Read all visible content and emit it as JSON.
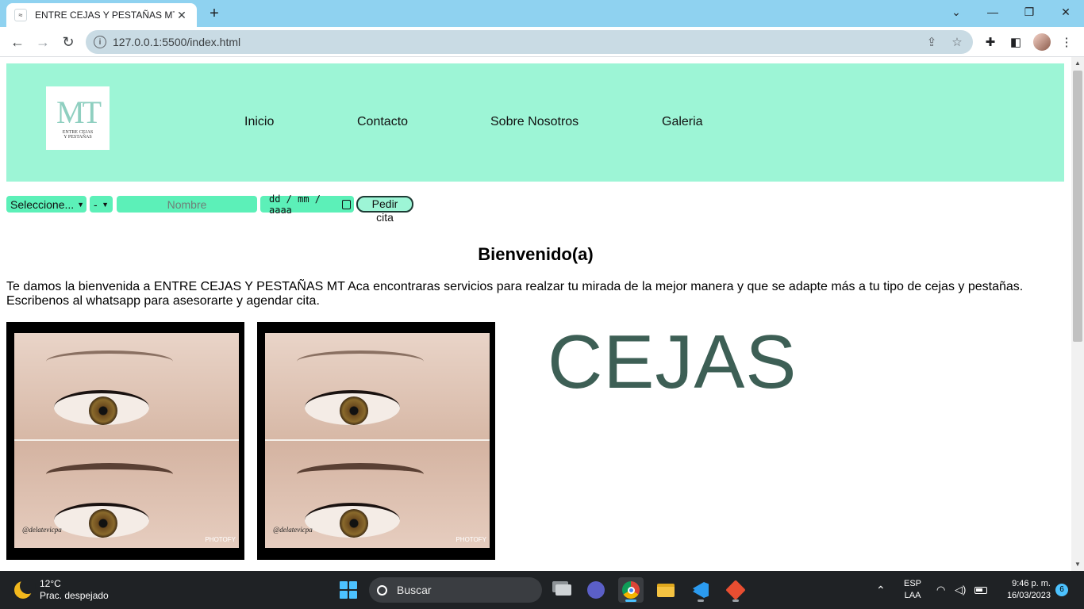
{
  "browser": {
    "tab_title": "ENTRE CEJAS Y PESTAÑAS MT",
    "tab_close": "✕",
    "new_tab": "+",
    "url": "127.0.0.1:5500/index.html"
  },
  "site": {
    "logo": {
      "monogram": "MT",
      "subtitle": "ENTRE CEJAS Y PESTAÑAS"
    },
    "menu": [
      {
        "label": "Inicio"
      },
      {
        "label": "Contacto"
      },
      {
        "label": "Sobre Nosotros"
      },
      {
        "label": "Galeria"
      }
    ],
    "booking": {
      "service_select": "Seleccione...",
      "time_select": "-",
      "name_placeholder": "Nombre",
      "date_placeholder": "dd / mm / aaaa",
      "submit_label": "Pedir cita"
    },
    "welcome_title": "Bienvenido(a)",
    "welcome_text": "Te damos la bienvenida a ENTRE CEJAS Y PESTAÑAS MT Aca encontraras servicios para realzar tu mirada de la mejor manera y que se adapte más a tu tipo de cejas y pestañas. Escribenos al whatsapp para asesorarte y agendar cita.",
    "gallery": [
      {
        "watermark": "@delatevicpa",
        "brand": "PHOTOFY"
      },
      {
        "watermark": "@delatevicpa",
        "brand": "PHOTOFY"
      }
    ],
    "section_title": "CEJAS"
  },
  "taskbar": {
    "weather_temp": "12°C",
    "weather_desc": "Prac. despejado",
    "search_label": "Buscar",
    "lang_top": "ESP",
    "lang_bottom": "LAA",
    "time": "9:46 p. m.",
    "date": "16/03/2023",
    "notifications": "6"
  },
  "colors": {
    "header_bg": "#9df5d6",
    "field_bg": "#5cf0b8",
    "section_title": "#3d5f55",
    "tabbar": "#8fd2f0"
  }
}
